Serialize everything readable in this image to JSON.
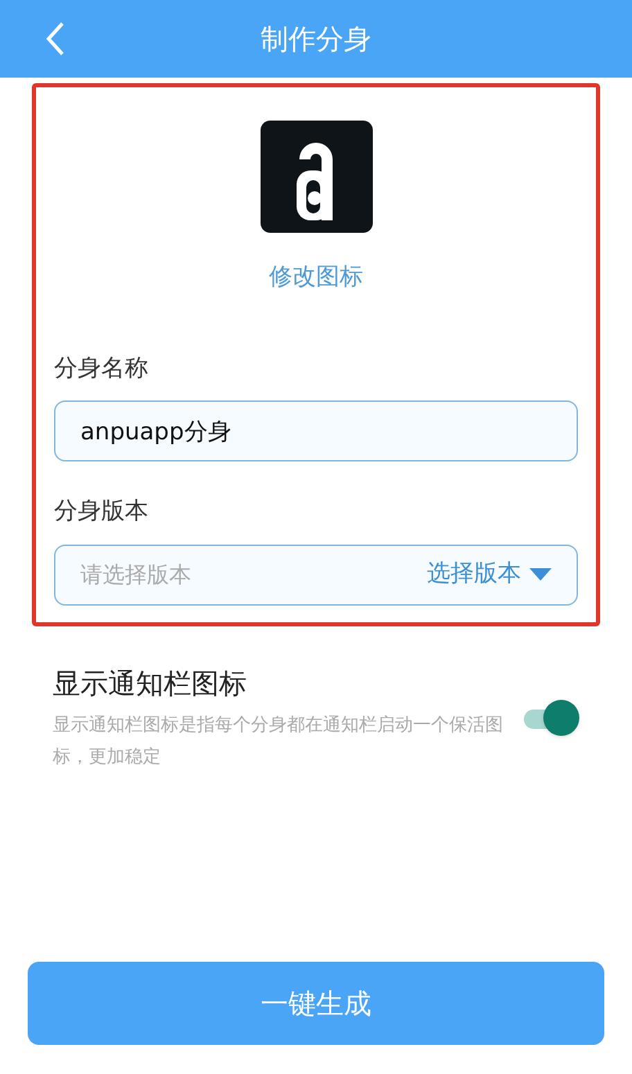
{
  "header": {
    "title": "制作分身"
  },
  "icon_section": {
    "change_icon_link": "修改图标"
  },
  "name_field": {
    "label": "分身名称",
    "value": "anpuapp分身"
  },
  "version_field": {
    "label": "分身版本",
    "placeholder": "请选择版本",
    "action": "选择版本"
  },
  "notification_setting": {
    "title": "显示通知栏图标",
    "description": "显示通知栏图标是指每个分身都在通知栏启动一个保活图标，更加稳定",
    "on": true
  },
  "primary_button": "一键生成"
}
